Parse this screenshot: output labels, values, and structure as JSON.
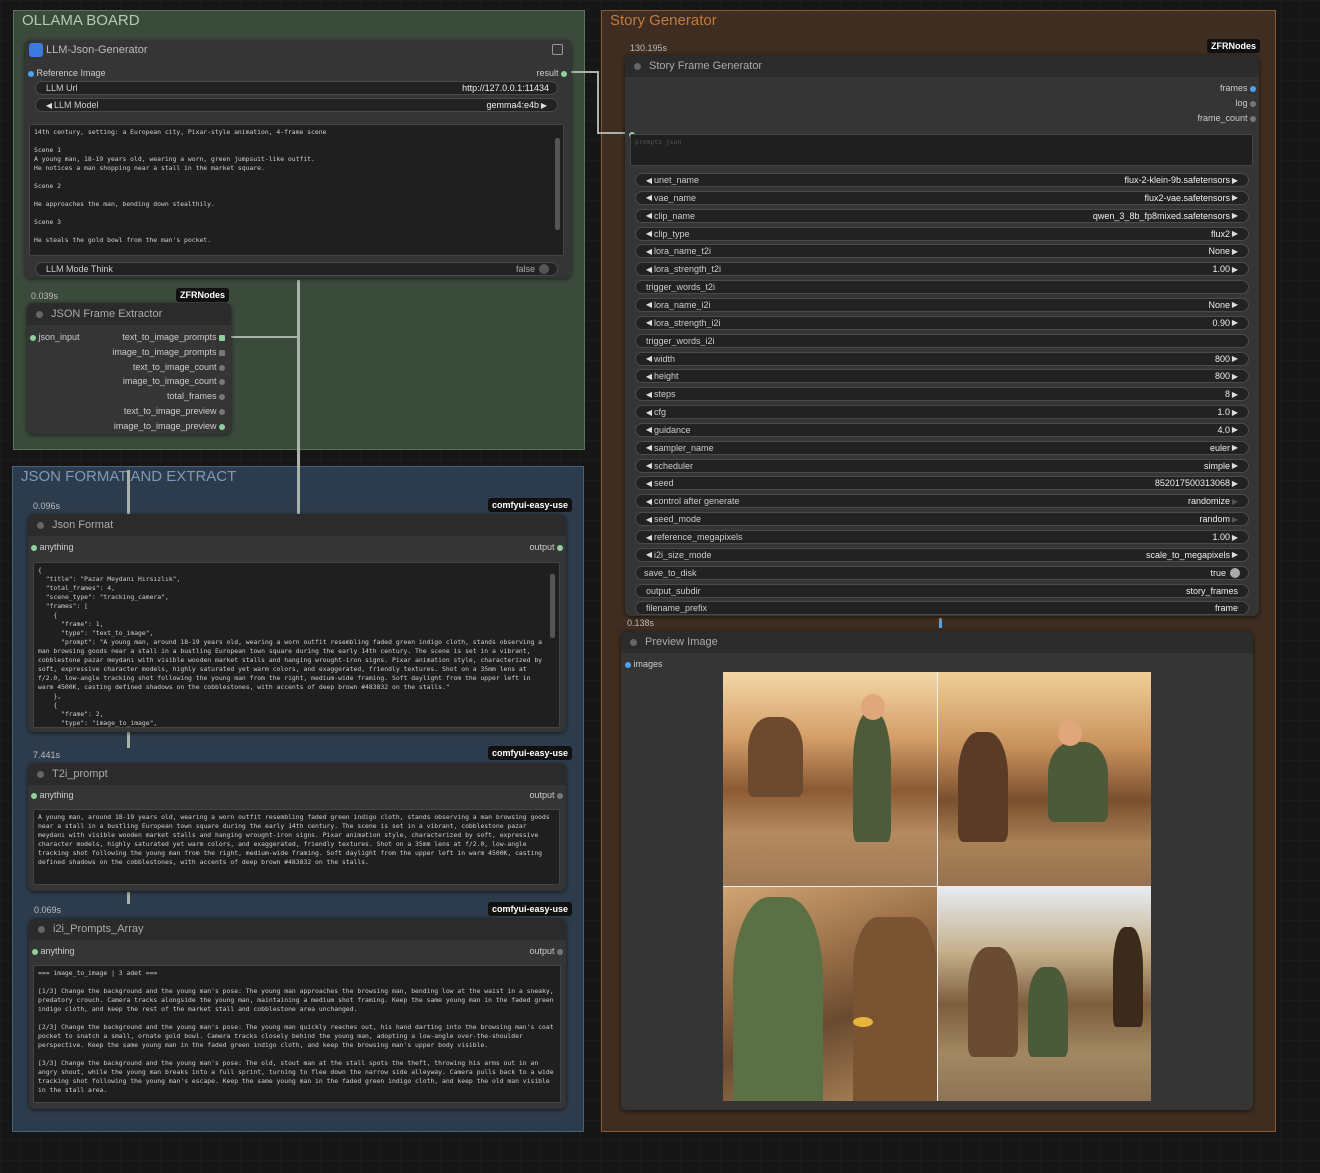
{
  "groups": {
    "ollama": "OLLAMA BOARD",
    "json": "JSON FORMAT AND EXTRACT",
    "story": "Story Generator"
  },
  "llm_node": {
    "title": "LLM-Json-Generator",
    "input_label": "Reference Image",
    "output_label": "result",
    "url_label": "LLM Url",
    "url_value": "http://127.0.0.1:11434",
    "model_label": "LLM Model",
    "model_value": "gemma4:e4b",
    "prompt_text": "14th century, setting: a European city, Pixar-style animation, 4-frame scene\n\nScene 1\nA young man, 18-19 years old, wearing a worn, green jumpsuit-like outfit.\nHe notices a man shopping near a stall in the market square.\n\nScene 2\n\nHe approaches the man, bending down stealthily.\n\nScene 3\n\nHe steals the gold bowl from the man's pocket.\n\nScene 4",
    "think_label": "LLM Mode Think",
    "think_value": "false"
  },
  "extractor_node": {
    "time": "0.039s",
    "tag": "ZFRNodes",
    "title": "JSON Frame Extractor",
    "input": "json_input",
    "outputs": [
      "text_to_image_prompts",
      "image_to_image_prompts",
      "text_to_image_count",
      "image_to_image_count",
      "total_frames",
      "text_to_image_preview",
      "image_to_image_preview"
    ]
  },
  "json_format_node": {
    "time": "0.096s",
    "tag": "comfyui-easy-use",
    "title": "Json Format",
    "input": "anything",
    "output": "output",
    "text": "{\n  \"title\": \"Pazar Meydanı Hırsızlık\",\n  \"total_frames\": 4,\n  \"scene_type\": \"tracking_camera\",\n  \"frames\": [\n    {\n      \"frame\": 1,\n      \"type\": \"text_to_image\",\n      \"prompt\": \"A young man, around 18-19 years old, wearing a worn outfit resembling faded green indigo cloth, stands observing a man browsing goods near a stall in a bustling European town square during the early 14th century. The scene is set in a vibrant, cobblestone pazar meydanı with visible wooden market stalls and hanging wrought-iron signs. Pixar animation style, characterized by soft, expressive character models, highly saturated yet warm colors, and exaggerated, friendly textures. Shot on a 35mm lens at f/2.0, low-angle tracking shot following the young man from the right, medium-wide framing. Soft daylight from the upper left in warm 4500K, casting defined shadows on the cobblestones, with accents of deep brown #483832 on the stalls.\"\n    },\n    {\n      \"frame\": 2,\n      \"type\": \"image_to_image\","
  },
  "t2i_node": {
    "time": "7.441s",
    "tag": "comfyui-easy-use",
    "title": "T2i_prompt",
    "input": "anything",
    "output": "output",
    "text": "A young man, around 18-19 years old, wearing a worn outfit resembling faded green indigo cloth, stands observing a man browsing goods near a stall in a bustling European town square during the early 14th century. The scene is set in a vibrant, cobblestone pazar meydanı with visible wooden market stalls and hanging wrought-iron signs. Pixar animation style, characterized by soft, expressive character models, highly saturated yet warm colors, and exaggerated, friendly textures. Shot on a 35mm lens at f/2.0, low-angle tracking shot following the young man from the right, medium-wide framing. Soft daylight from the upper left in warm 4500K, casting defined shadows on the cobblestones, with accents of deep brown #483832 on the stalls."
  },
  "i2i_node": {
    "time": "0.069s",
    "tag": "comfyui-easy-use",
    "title": "i2i_Prompts_Array",
    "input": "anything",
    "output": "output",
    "text": "=== image_to_image | 3 adet ===\n\n[1/3] Change the background and the young man's pose: The young man approaches the browsing man, bending low at the waist in a sneaky, predatory crouch. Camera tracks alongside the young man, maintaining a medium shot framing. Keep the same young man in the faded green indigo cloth, and keep the rest of the market stall and cobblestone area unchanged.\n\n[2/3] Change the background and the young man's pose: The young man quickly reaches out, his hand darting into the browsing man's coat pocket to snatch a small, ornate gold bowl. Camera tracks closely behind the young man, adopting a low-angle over-the-shoulder perspective. Keep the same young man in the faded green indigo cloth, and keep the browsing man's upper body visible.\n\n[3/3] Change the background and the young man's pose: The old, stout man at the stall spots the theft, throwing his arms out in an angry shout, while the young man breaks into a full sprint, turning to flee down the narrow side alleyway. Camera pulls back to a wide tracking shot following the young man's escape. Keep the same young man in the faded green indigo cloth, and keep the old man visible in the stall area."
  },
  "story_node": {
    "time": "130.195s",
    "tag": "ZFRNodes",
    "title": "Story Frame Generator",
    "outputs": [
      "frames",
      "log",
      "frame_count"
    ],
    "prompt_input_placeholder": "prompts_json",
    "widgets": [
      {
        "label": "unet_name",
        "value": "flux-2-klein-9b.safetensors",
        "arrows": true
      },
      {
        "label": "vae_name",
        "value": "flux2-vae.safetensors",
        "arrows": true
      },
      {
        "label": "clip_name",
        "value": "qwen_3_8b_fp8mixed.safetensors",
        "arrows": true
      },
      {
        "label": "clip_type",
        "value": "flux2",
        "arrows": true
      },
      {
        "label": "lora_name_t2i",
        "value": "None",
        "arrows": true
      },
      {
        "label": "lora_strength_t2i",
        "value": "1.00",
        "arrows": true
      },
      {
        "label": "trigger_words_t2i",
        "value": "",
        "arrows": false
      },
      {
        "label": "lora_name_i2i",
        "value": "None",
        "arrows": true
      },
      {
        "label": "lora_strength_i2i",
        "value": "0.90",
        "arrows": true
      },
      {
        "label": "trigger_words_i2i",
        "value": "",
        "arrows": false
      },
      {
        "label": "width",
        "value": "800",
        "arrows": true
      },
      {
        "label": "height",
        "value": "800",
        "arrows": true
      },
      {
        "label": "steps",
        "value": "8",
        "arrows": true
      },
      {
        "label": "cfg",
        "value": "1.0",
        "arrows": true
      },
      {
        "label": "guidance",
        "value": "4.0",
        "arrows": true
      },
      {
        "label": "sampler_name",
        "value": "euler",
        "arrows": true
      },
      {
        "label": "scheduler",
        "value": "simple",
        "arrows": true
      },
      {
        "label": "seed",
        "value": "852017500313068",
        "arrows": true
      },
      {
        "label": "control after generate",
        "value": "randomize",
        "arrows": true,
        "dim": true
      },
      {
        "label": "seed_mode",
        "value": "random",
        "arrows": true,
        "dim": true
      },
      {
        "label": "reference_megapixels",
        "value": "1.00",
        "arrows": true
      },
      {
        "label": "i2i_size_mode",
        "value": "scale_to_megapixels",
        "arrows": true
      },
      {
        "label": "save_to_disk",
        "value": "true",
        "toggle": true
      },
      {
        "label": "output_subdir",
        "value": "story_frames",
        "arrows": false
      },
      {
        "label": "filename_prefix",
        "value": "frame",
        "arrows": false
      }
    ]
  },
  "preview_node": {
    "time": "0.138s",
    "title": "Preview Image",
    "input": "images"
  }
}
